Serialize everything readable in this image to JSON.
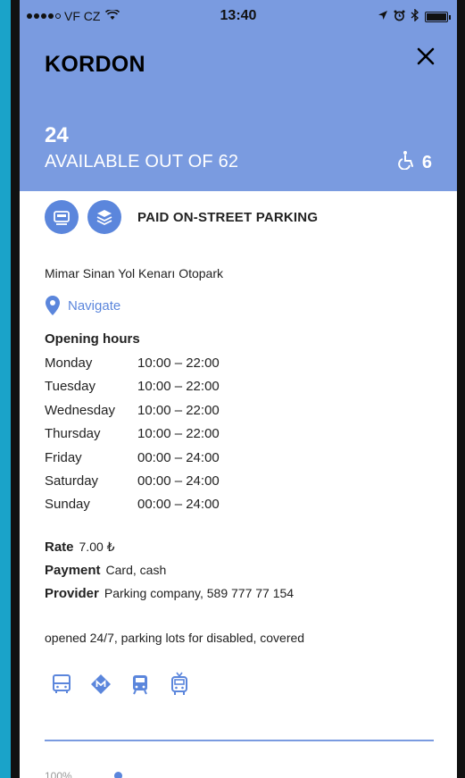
{
  "status_bar": {
    "carrier": "VF CZ",
    "time": "13:40"
  },
  "parking": {
    "name": "KORDON",
    "available": "24",
    "available_label": "AVAILABLE OUT OF 62",
    "disabled_spots": "6",
    "type_label": "PAID ON-STREET PARKING",
    "address": "Mimar Sinan Yol Kenarı Otopark",
    "navigate_label": "Navigate"
  },
  "hours": {
    "title": "Opening hours",
    "days": [
      {
        "day": "Monday",
        "time": "10:00 – 22:00"
      },
      {
        "day": "Tuesday",
        "time": "10:00 – 22:00"
      },
      {
        "day": "Wednesday",
        "time": "10:00 – 22:00"
      },
      {
        "day": "Thursday",
        "time": "10:00 – 22:00"
      },
      {
        "day": "Friday",
        "time": "00:00 – 24:00"
      },
      {
        "day": "Saturday",
        "time": "00:00 – 24:00"
      },
      {
        "day": "Sunday",
        "time": "00:00 – 24:00"
      }
    ]
  },
  "info": {
    "rate_label": "Rate",
    "rate_value": "7.00 ₺",
    "payment_label": "Payment",
    "payment_value": "Card, cash",
    "provider_label": "Provider",
    "provider_value": "Parking company, 589 777 77 154"
  },
  "features": "opened 24/7, parking lots for disabled, covered",
  "occupancy": {
    "label": "100%"
  },
  "icons": {
    "header_close": "close-icon",
    "disabled": "wheelchair-icon",
    "type_1": "parking-meter-icon",
    "type_2": "card-stack-icon",
    "location": "location-pin-icon",
    "transport": [
      "bus-icon",
      "metro-icon",
      "tram-icon",
      "trolleybus-icon"
    ]
  },
  "colors": {
    "header_bg": "#7a9be0",
    "accent": "#5b86dc"
  }
}
